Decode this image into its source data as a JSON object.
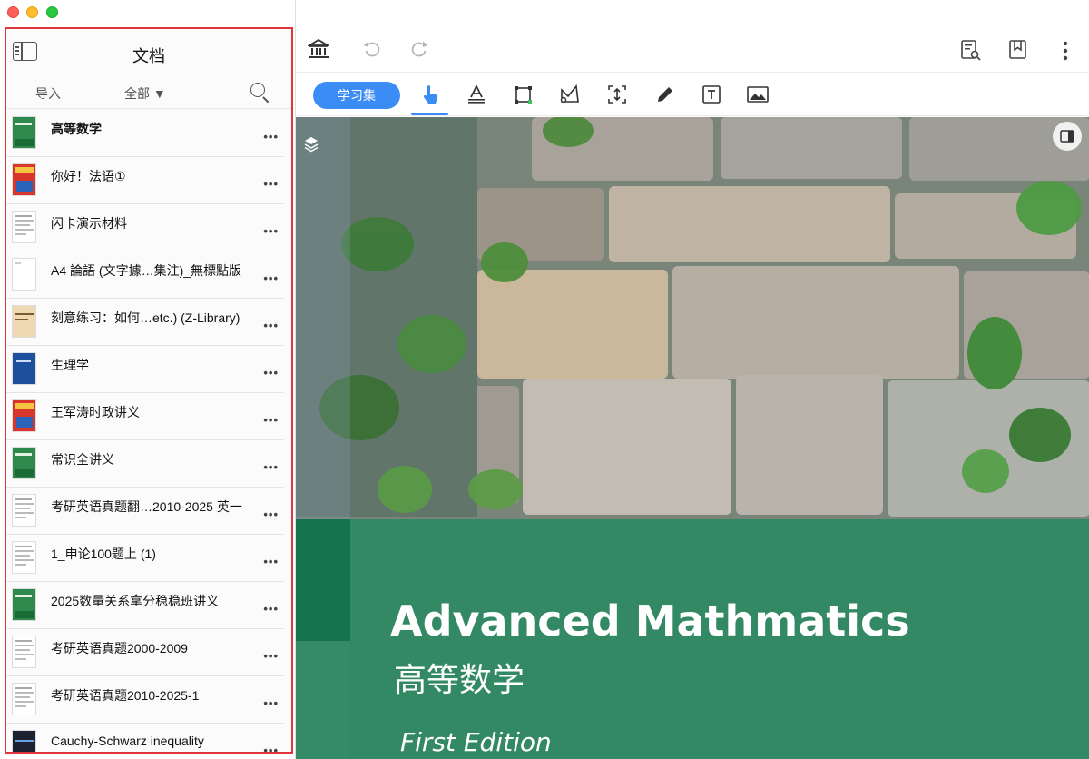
{
  "window": {
    "controls": [
      "close",
      "minimize",
      "zoom"
    ]
  },
  "sidebar": {
    "title": "文档",
    "import_label": "导入",
    "filter_label": "全部 ▼",
    "documents": [
      {
        "title": "高等数学",
        "bold": true,
        "thumb": "green-cover"
      },
      {
        "title": "你好！法语①",
        "bold": false,
        "thumb": "red-cover"
      },
      {
        "title": "闪卡演示材料",
        "bold": false,
        "thumb": "text-page"
      },
      {
        "title": "A4 論語 (文字據…集注)_無標點版",
        "bold": false,
        "thumb": "blank-page"
      },
      {
        "title": "刻意练习：如何…etc.) (Z-Library)",
        "bold": false,
        "thumb": "beige-cover"
      },
      {
        "title": "生理学",
        "bold": false,
        "thumb": "blue-cover"
      },
      {
        "title": "王军涛时政讲义",
        "bold": false,
        "thumb": "red-cover"
      },
      {
        "title": "常识全讲义",
        "bold": false,
        "thumb": "green-cover"
      },
      {
        "title": "考研英语真题翻…2010-2025 英一",
        "bold": false,
        "thumb": "text-page"
      },
      {
        "title": "1_申论100题上 (1)",
        "bold": false,
        "thumb": "text-page"
      },
      {
        "title": "2025数量关系拿分稳稳班讲义",
        "bold": false,
        "thumb": "green-cover"
      },
      {
        "title": "考研英语真题2000-2009",
        "bold": false,
        "thumb": "text-page"
      },
      {
        "title": "考研英语真题2010-2025-1",
        "bold": false,
        "thumb": "text-page"
      },
      {
        "title": "Cauchy-Schwarz inequality",
        "bold": false,
        "thumb": "dark-cover"
      }
    ],
    "more_label": "•••"
  },
  "topbar": {
    "icons": [
      "library-icon",
      "undo-icon",
      "redo-icon",
      "document-search-icon",
      "bookmark-icon",
      "more-vertical-icon"
    ]
  },
  "toolbar": {
    "study_set_label": "学习集",
    "tools": [
      "pointer-tool-icon",
      "text-highlight-tool-icon",
      "rectangle-select-tool-icon",
      "lasso-tool-icon",
      "crop-tool-icon",
      "pen-tool-icon",
      "text-box-tool-icon",
      "image-tool-icon"
    ],
    "accent": "#3b8df5"
  },
  "page": {
    "title_en": "Advanced Mathmatics",
    "title_zh": "高等数学",
    "edition": "First Edition",
    "band_color": "#1f8a5c"
  }
}
